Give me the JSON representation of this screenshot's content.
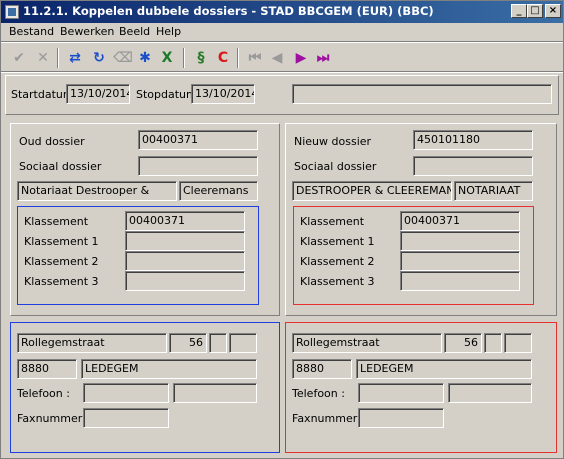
{
  "window": {
    "title": "11.2.1. Koppelen dubbele dossiers - STAD BBCGEM (EUR) (BBC)",
    "controls": {
      "minimize": "_",
      "maximize": "□",
      "close": "×"
    }
  },
  "menu": [
    "Bestand",
    "Bewerken",
    "Beeld",
    "Help"
  ],
  "toolbar": {
    "buttons": [
      {
        "name": "accept-icon",
        "glyph": "✔",
        "color": "#9a9a9a"
      },
      {
        "name": "cancel-icon",
        "glyph": "✕",
        "color": "#9a9a9a"
      },
      {
        "name": "link-icon",
        "glyph": "⇄",
        "color": "#1a4fc9"
      },
      {
        "name": "refresh-icon",
        "glyph": "↻",
        "color": "#1a4fc9"
      },
      {
        "name": "clear-icon",
        "glyph": "⌫",
        "color": "#9a9a9a"
      },
      {
        "name": "grid-icon",
        "glyph": "✱",
        "color": "#1a4fc9"
      },
      {
        "name": "excel-icon",
        "glyph": "X",
        "color": "#1a7a2a"
      },
      {
        "name": "script-icon",
        "glyph": "§",
        "color": "#2a7a2a"
      },
      {
        "name": "c-icon",
        "glyph": "C",
        "color": "#d81818"
      },
      {
        "name": "first-icon",
        "glyph": "⏮",
        "color": "#9a9a9a"
      },
      {
        "name": "prev-icon",
        "glyph": "◀",
        "color": "#9a9a9a"
      },
      {
        "name": "next-icon",
        "glyph": "▶",
        "color": "#a010a0"
      },
      {
        "name": "last-icon",
        "glyph": "⏭",
        "color": "#a010a0"
      }
    ]
  },
  "header": {
    "startdatum_label": "Startdatum",
    "startdatum_value": "13/10/2014",
    "stopdatum_label": "Stopdatum",
    "stopdatum_value": "13/10/2014",
    "extra_value": ""
  },
  "old": {
    "dossier_label": "Oud dossier",
    "dossier_value": "00400371",
    "sociaal_label": "Sociaal dossier",
    "sociaal_value": "",
    "name1": "Notariaat Destrooper &",
    "name2": "Cleeremans",
    "klassement_label": "Klassement",
    "klassement_value": "00400371",
    "k1_label": "Klassement 1",
    "k1_value": "",
    "k2_label": "Klassement 2",
    "k2_value": "",
    "k3_label": "Klassement 3",
    "k3_value": "",
    "border_color": "#1f3fe0"
  },
  "new": {
    "dossier_label": "Nieuw dossier",
    "dossier_value": "450101180",
    "sociaal_label": "Sociaal dossier",
    "sociaal_value": "",
    "name1": "DESTROOPER & CLEEREMAN",
    "name2": "NOTARIAAT",
    "klassement_label": "Klassement",
    "klassement_value": "00400371",
    "k1_label": "Klassement 1",
    "k1_value": "",
    "k2_label": "Klassement 2",
    "k2_value": "",
    "k3_label": "Klassement 3",
    "k3_value": "",
    "border_color": "#e83030"
  },
  "old_address": {
    "street": "Rollegemstraat",
    "number": "56",
    "bus1": "",
    "bus2": "",
    "postcode": "8880",
    "city": "LEDEGEM",
    "telefoon_label": "Telefoon :",
    "telefoon1": "",
    "telefoon2": "",
    "fax_label": "Faxnummer :",
    "fax": ""
  },
  "new_address": {
    "street": "Rollegemstraat",
    "number": "56",
    "bus1": "",
    "bus2": "",
    "postcode": "8880",
    "city": "LEDEGEM",
    "telefoon_label": "Telefoon :",
    "telefoon1": "",
    "telefoon2": "",
    "fax_label": "Faxnummer :",
    "fax": ""
  }
}
